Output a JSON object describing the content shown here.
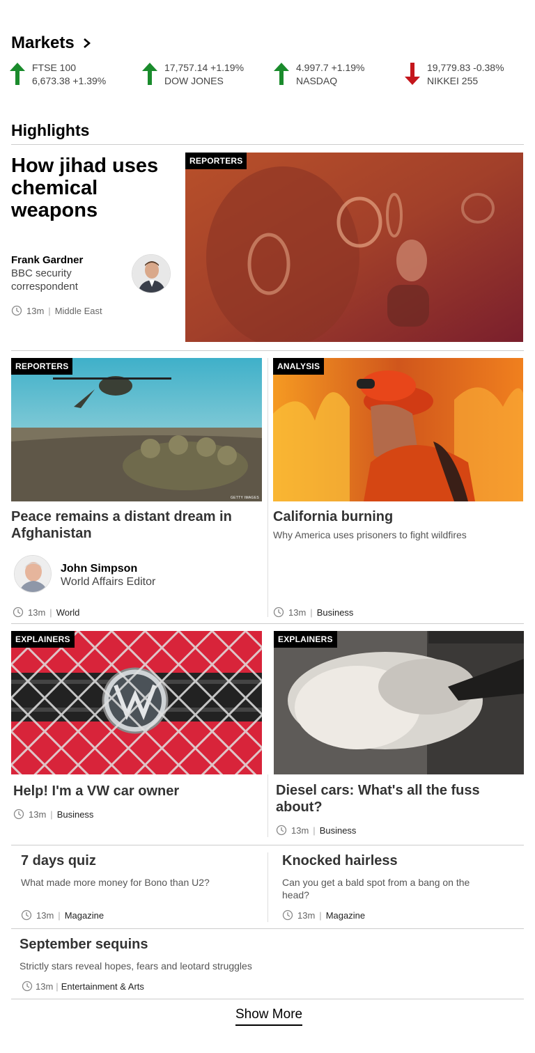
{
  "markets": {
    "title": "Markets",
    "tickers": [
      {
        "line1": "FTSE 100",
        "line2": "6,673.38 +1.39%",
        "direction": "up"
      },
      {
        "line1": "17,757.14 +1.19%",
        "line2": "DOW JONES",
        "direction": "up"
      },
      {
        "line1": "4.997.7 +1.19%",
        "line2": "NASDAQ",
        "direction": "up"
      },
      {
        "line1": "19,779.83 -0.38%",
        "line2": "NIKKEI 255",
        "direction": "down"
      }
    ],
    "colors": {
      "up": "#1a8b2c",
      "down": "#c4161c"
    }
  },
  "highlights": {
    "title": "Highlights",
    "lead": {
      "headline": "How jihad uses chemical weapons",
      "author_name": "Frank Gardner",
      "author_role": "BBC security correspondent",
      "time": "13m",
      "section": "Middle East",
      "tag": "REPORTERS"
    },
    "stories": [
      {
        "tag": "REPORTERS",
        "headline": "Peace remains a distant dream in Afghanistan",
        "author_name": "John Simpson",
        "author_role": "World Affairs Editor",
        "time": "13m",
        "section": "World",
        "image_credit": "GETTY IMAGES"
      },
      {
        "tag": "ANALYSIS",
        "headline": "California burning",
        "summary": "Why America uses prisoners to fight wildfires",
        "time": "13m",
        "section": "Business"
      },
      {
        "tag": "EXPLAINERS",
        "headline": "Help! I'm a VW car owner",
        "time": "13m",
        "section": "Business"
      },
      {
        "tag": "EXPLAINERS",
        "headline": "Diesel cars: What's all the fuss about?",
        "time": "13m",
        "section": "Business"
      },
      {
        "headline": "7 days quiz",
        "summary": "What made more money for Bono than U2?",
        "time": "13m",
        "section": "Magazine"
      },
      {
        "headline": "Knocked hairless",
        "summary": "Can you get a bald spot from a bang on the head?",
        "time": "13m",
        "section": "Magazine"
      },
      {
        "headline": "September sequins",
        "summary": "Strictly stars reveal hopes, fears and leotard struggles",
        "time": "13m",
        "section": "Entertainment & Arts"
      }
    ]
  },
  "show_more": "Show More"
}
